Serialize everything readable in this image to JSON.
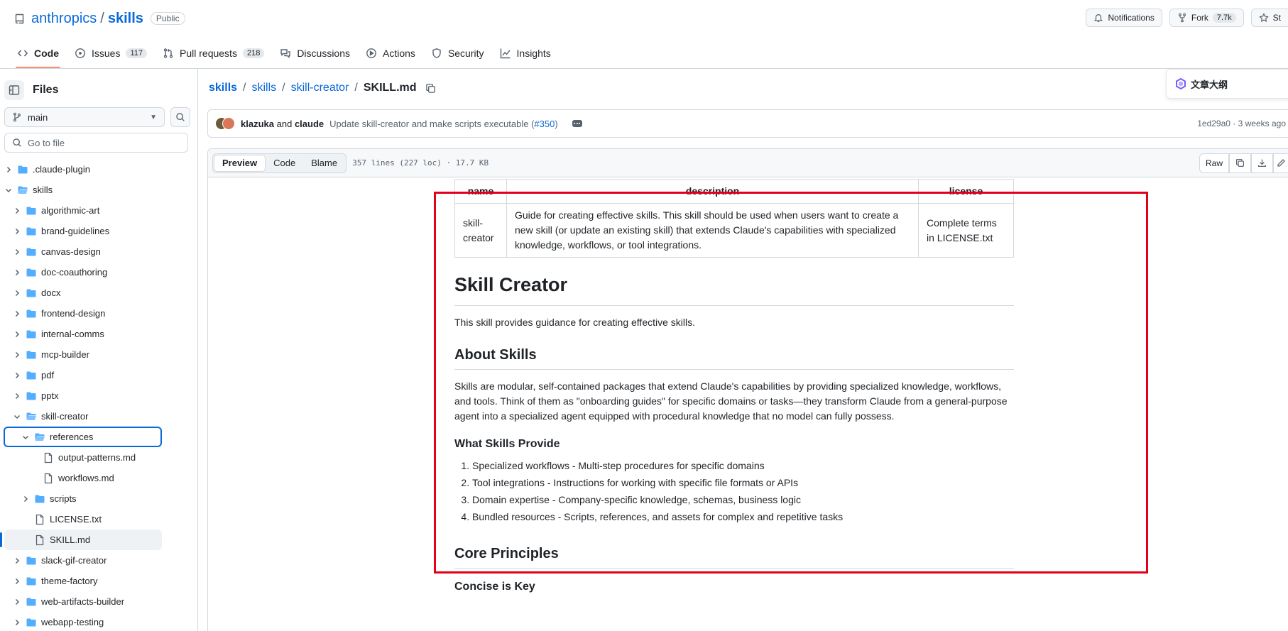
{
  "repo": {
    "owner": "anthropics",
    "sep": "/",
    "name": "skills",
    "visibility": "Public"
  },
  "header_actions": {
    "notifications": "Notifications",
    "fork": "Fork",
    "fork_count": "7.7k",
    "star": "St"
  },
  "tabs": [
    {
      "label": "Code",
      "icon": "code-icon",
      "active": true
    },
    {
      "label": "Issues",
      "icon": "issue-icon",
      "count": "117"
    },
    {
      "label": "Pull requests",
      "icon": "pull-request-icon",
      "count": "218"
    },
    {
      "label": "Discussions",
      "icon": "discussions-icon"
    },
    {
      "label": "Actions",
      "icon": "play-icon"
    },
    {
      "label": "Security",
      "icon": "shield-icon"
    },
    {
      "label": "Insights",
      "icon": "graph-icon"
    }
  ],
  "sidebar": {
    "title": "Files",
    "branch": "main",
    "goto_placeholder": "Go to file",
    "tree": [
      {
        "label": ".claude-plugin",
        "type": "folder",
        "depth": 0,
        "open": false
      },
      {
        "label": "skills",
        "type": "folder",
        "depth": 0,
        "open": true
      },
      {
        "label": "algorithmic-art",
        "type": "folder",
        "depth": 1,
        "open": false
      },
      {
        "label": "brand-guidelines",
        "type": "folder",
        "depth": 1,
        "open": false
      },
      {
        "label": "canvas-design",
        "type": "folder",
        "depth": 1,
        "open": false
      },
      {
        "label": "doc-coauthoring",
        "type": "folder",
        "depth": 1,
        "open": false
      },
      {
        "label": "docx",
        "type": "folder",
        "depth": 1,
        "open": false
      },
      {
        "label": "frontend-design",
        "type": "folder",
        "depth": 1,
        "open": false
      },
      {
        "label": "internal-comms",
        "type": "folder",
        "depth": 1,
        "open": false
      },
      {
        "label": "mcp-builder",
        "type": "folder",
        "depth": 1,
        "open": false
      },
      {
        "label": "pdf",
        "type": "folder",
        "depth": 1,
        "open": false
      },
      {
        "label": "pptx",
        "type": "folder",
        "depth": 1,
        "open": false
      },
      {
        "label": "skill-creator",
        "type": "folder",
        "depth": 1,
        "open": true
      },
      {
        "label": "references",
        "type": "folder",
        "depth": 2,
        "open": true,
        "focused": true
      },
      {
        "label": "output-patterns.md",
        "type": "file",
        "depth": 3
      },
      {
        "label": "workflows.md",
        "type": "file",
        "depth": 3
      },
      {
        "label": "scripts",
        "type": "folder",
        "depth": 2,
        "open": false
      },
      {
        "label": "LICENSE.txt",
        "type": "file",
        "depth": 2
      },
      {
        "label": "SKILL.md",
        "type": "file",
        "depth": 2,
        "selected": true
      },
      {
        "label": "slack-gif-creator",
        "type": "folder",
        "depth": 1,
        "open": false
      },
      {
        "label": "theme-factory",
        "type": "folder",
        "depth": 1,
        "open": false
      },
      {
        "label": "web-artifacts-builder",
        "type": "folder",
        "depth": 1,
        "open": false
      },
      {
        "label": "webapp-testing",
        "type": "folder",
        "depth": 1,
        "open": false
      }
    ]
  },
  "breadcrumb": {
    "p1": "skills",
    "p2": "skills",
    "p3": "skill-creator",
    "current": "SKILL.md",
    "sep": "/"
  },
  "outline_button": "文章大纲",
  "commit": {
    "author1": "klazuka",
    "and": "and",
    "author2": "claude",
    "message": "Update skill-creator and make scripts executable (",
    "pr": "#350",
    "message_end": ")",
    "sha": "1ed29a0",
    "time": "3 weeks ago"
  },
  "file": {
    "views": [
      "Preview",
      "Code",
      "Blame"
    ],
    "info": "357 lines (227 loc) · 17.7 KB",
    "raw_label": "Raw"
  },
  "doc": {
    "table_headers": [
      "name",
      "description",
      "license"
    ],
    "table_row": [
      "skill-creator",
      "Guide for creating effective skills. This skill should be used when users want to create a new skill (or update an existing skill) that extends Claude's capabilities with specialized knowledge, workflows, or tool integrations.",
      "Complete terms in LICENSE.txt"
    ],
    "h1": "Skill Creator",
    "intro": "This skill provides guidance for creating effective skills.",
    "h2_about": "About Skills",
    "about_p": "Skills are modular, self-contained packages that extend Claude's capabilities by providing specialized knowledge, workflows, and tools. Think of them as \"onboarding guides\" for specific domains or tasks—they transform Claude from a general-purpose agent into a specialized agent equipped with procedural knowledge that no model can fully possess.",
    "h3_provide": "What Skills Provide",
    "provide_items": [
      "Specialized workflows - Multi-step procedures for specific domains",
      "Tool integrations - Instructions for working with specific file formats or APIs",
      "Domain expertise - Company-specific knowledge, schemas, business logic",
      "Bundled resources - Scripts, references, and assets for complex and repetitive tasks"
    ],
    "h2_core": "Core Principles",
    "h3_concise": "Concise is Key"
  },
  "colors": {
    "link": "#0969da",
    "highlight_box": "#e3001b",
    "folder": "#54aeff",
    "active_tab": "#fd8c73"
  }
}
